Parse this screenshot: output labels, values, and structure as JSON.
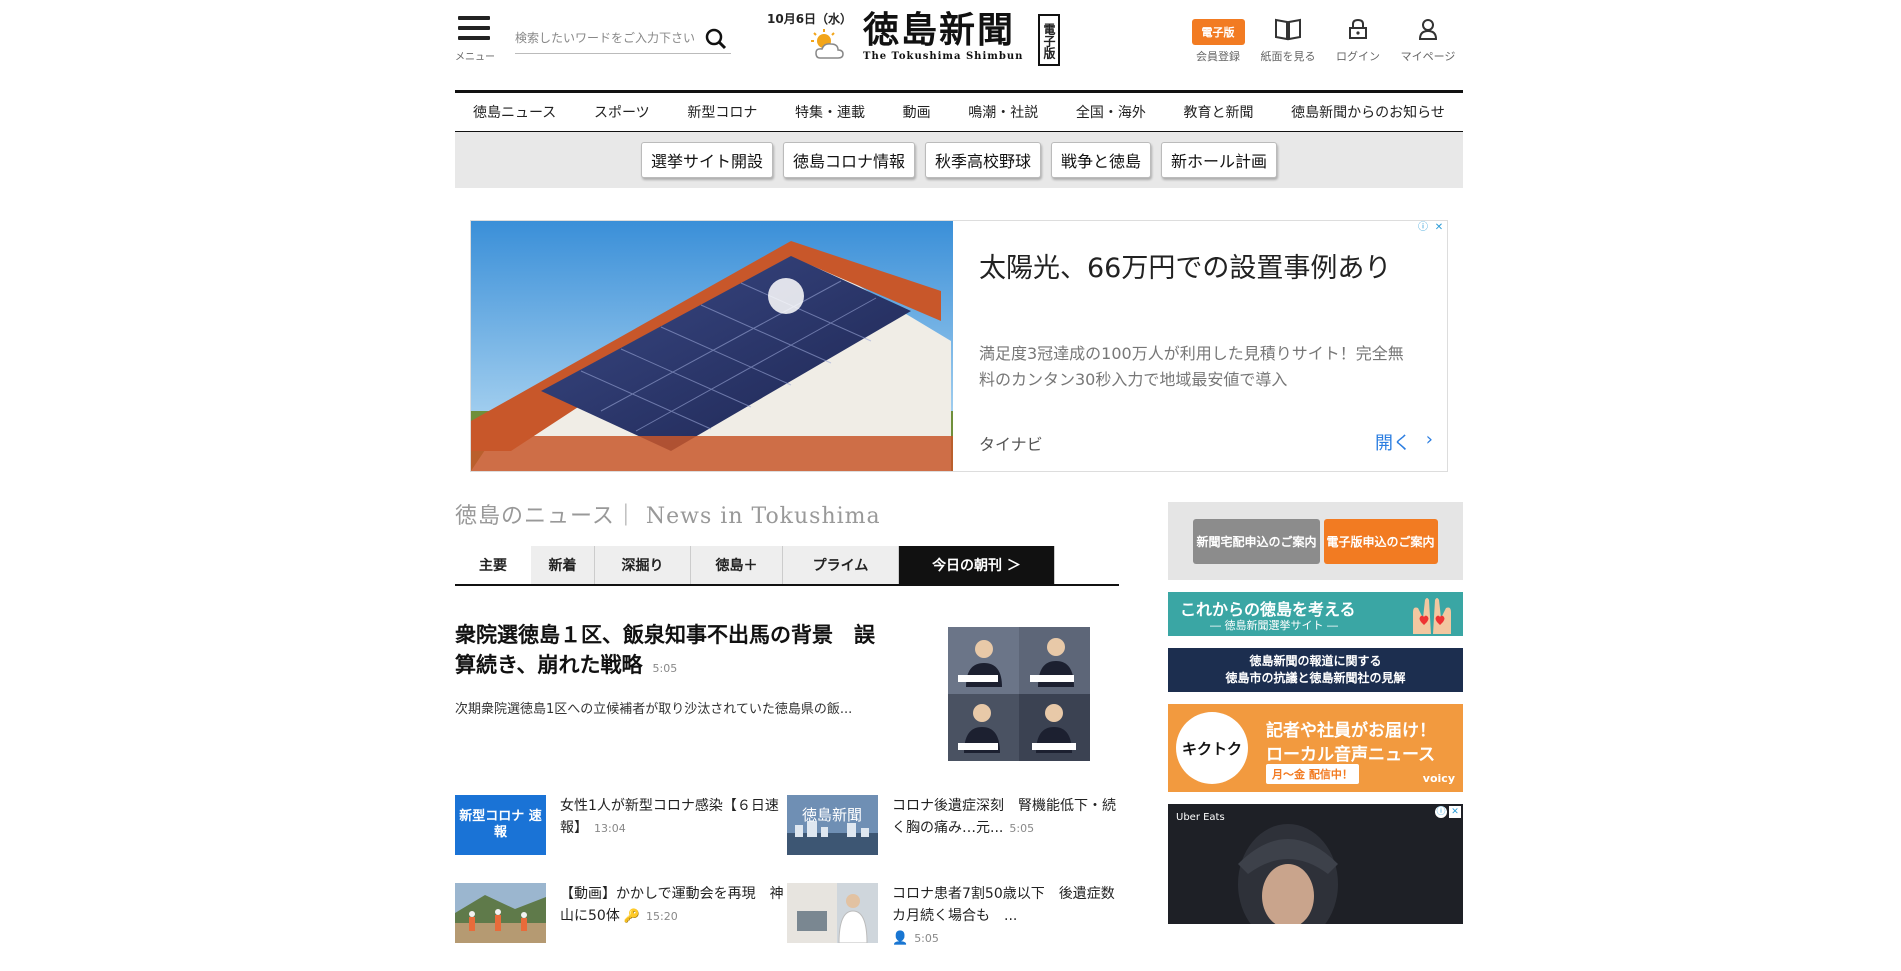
{
  "header": {
    "menu_label": "メニュー",
    "search_placeholder": "検索したいワードをご入力下さい",
    "date": "10月6日（水）",
    "logo_text": "徳島新聞",
    "logo_en": "The Tokushima Shimbun",
    "logo_badge": "電子版",
    "epaper_button": "電子版",
    "member_register": "会員登録",
    "view_paper": "紙面を見る",
    "login": "ログイン",
    "mypage": "マイページ"
  },
  "nav": [
    "徳島ニュース",
    "スポーツ",
    "新型コロナ",
    "特集・連載",
    "動画",
    "鳴潮・社説",
    "全国・海外",
    "教育と新聞",
    "徳島新聞からのお知らせ"
  ],
  "tags": [
    "選挙サイト開設",
    "徳島コロナ情報",
    "秋季高校野球",
    "戦争と徳島",
    "新ホール計画"
  ],
  "ad": {
    "title": "太陽光、66万円での設置事例あり",
    "desc": "満足度3冠達成の100万人が利用した見積りサイト！完全無料のカンタン30秒入力で地域最安値で導入",
    "source": "タイナビ",
    "open": "開く",
    "open_chevron": "›"
  },
  "section": {
    "heading": "徳島のニュース｜ News in Tokushima",
    "tabs": [
      "主要",
      "新着",
      "深掘り",
      "徳島＋",
      "プライム",
      "今日の朝刊 ＞"
    ]
  },
  "lead": {
    "title": "衆院選徳島１区、飯泉知事不出馬の背景　誤算続き、崩れた戦略",
    "time": "5:05",
    "summary": "次期衆院選徳島1区への立候補者が取り沙汰されていた徳島県の飯..."
  },
  "news": [
    {
      "thumb_label": "新型コロナ 速報",
      "title": "女性1人が新型コロナ感染【６日速報】",
      "time": "13:04"
    },
    {
      "thumb_label": "徳島新聞",
      "title": "コロナ後遺症深刻　腎機能低下・続く胸の痛み…元...",
      "time": "5:05"
    },
    {
      "thumb_label": "",
      "title": "【動画】かかしで運動会を再現　神山に50体",
      "time": "15:20"
    },
    {
      "thumb_label": "",
      "title": "コロナ患者7割50歳以下　後遺症数カ月続く場合も　...",
      "time": "5:05"
    }
  ],
  "sidebar": {
    "delivery": "新聞宅配申込のご案内",
    "digital": "電子版申込のご案内",
    "election_title": "これからの徳島を考える",
    "election_sub": "― 徳島新聞選挙サイト ―",
    "report_line1": "徳島新聞の報道に関する",
    "report_line2": "徳島市の抗議と徳島新聞社の見解",
    "voice_line1": "記者や社員がお届け！",
    "voice_line2": "ローカル音声ニュース",
    "voice_line3": "月〜金 配信中！",
    "voice_logo": "キクトク",
    "voice_brand": "voicy",
    "uber": "Uber Eats"
  },
  "colors": {
    "accent": "#f27b22",
    "corona": "#1a73d6",
    "link": "#2a7de1"
  }
}
